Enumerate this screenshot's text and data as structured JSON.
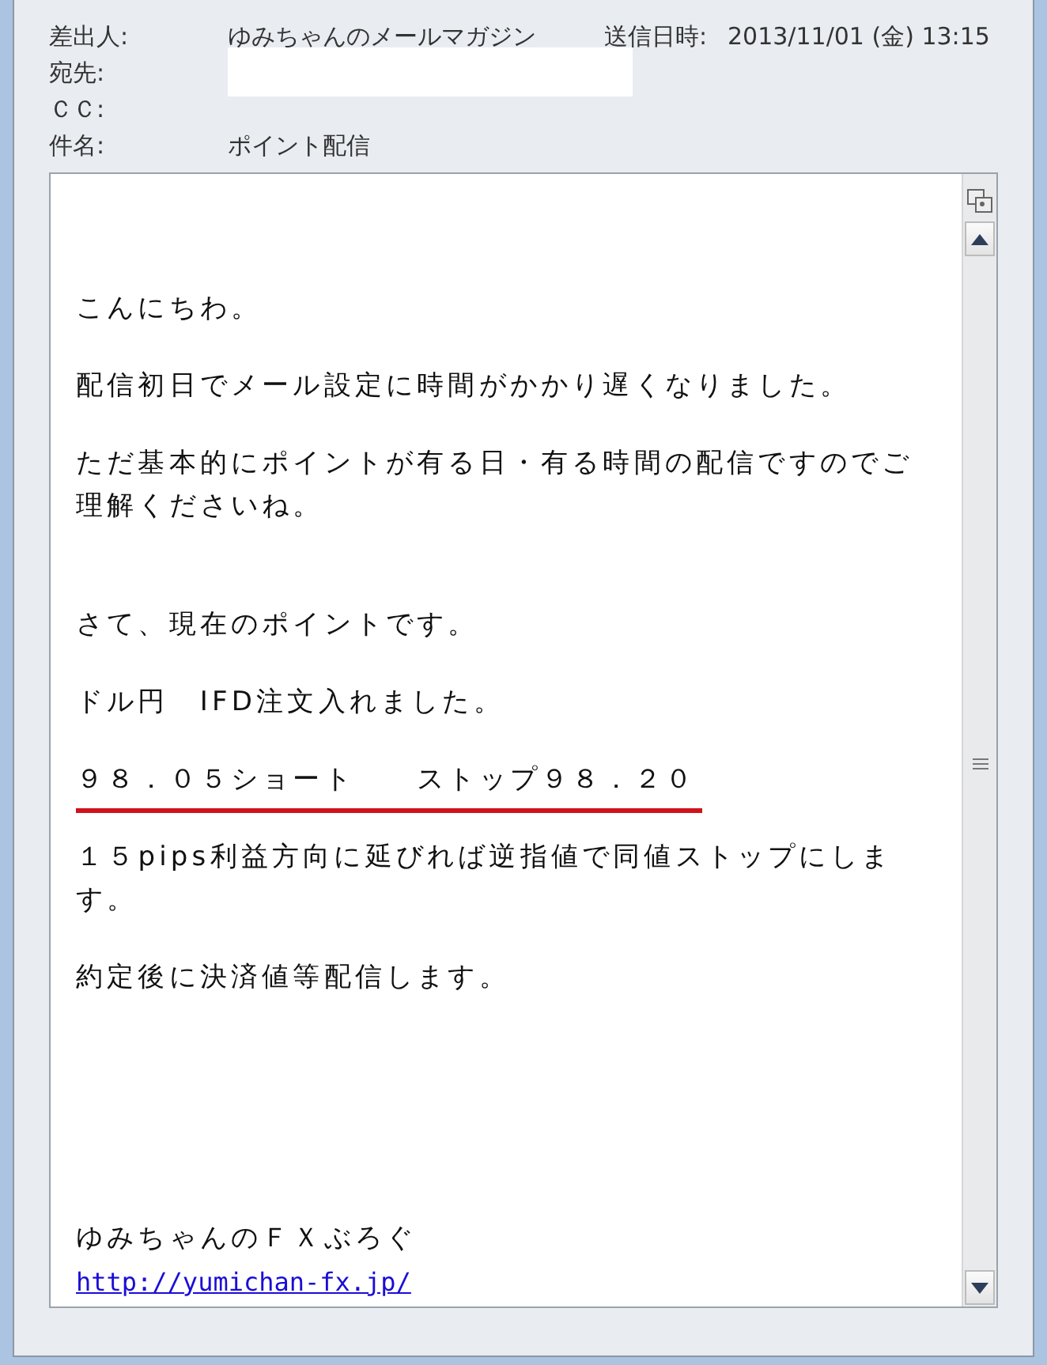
{
  "header": {
    "from_label": "差出人:",
    "from": "ゆみちゃんのメールマガジン",
    "sent_label": "送信日時:",
    "sent": "2013/11/01 (金) 13:15",
    "to_label": "宛先:",
    "cc_label": "ＣＣ:",
    "subject_label": "件名:",
    "subject": "ポイント配信"
  },
  "body": {
    "sections": [
      [
        {
          "kind": "text",
          "text": "こんにちわ。"
        },
        {
          "kind": "text",
          "text": "配信初日でメール設定に時間がかかり遅くなりました。"
        },
        {
          "kind": "text",
          "text": "ただ基本的にポイントが有る日・有る時間の配信ですのでご理解くださいね。"
        }
      ],
      [
        {
          "kind": "text",
          "text": "さて、現在のポイントです。"
        },
        {
          "kind": "text",
          "text": "ドル円　IFD注文入れました。"
        },
        {
          "kind": "underlined",
          "text": "９８．０５ショート　　ストップ９８．２０"
        },
        {
          "kind": "text",
          "text": "１５pips利益方向に延びれば逆指値で同値ストップにします。"
        },
        {
          "kind": "text",
          "text": "約定後に決済値等配信します。"
        }
      ]
    ],
    "signature": [
      {
        "kind": "text",
        "text": "ゆみちゃんのＦＸぶろぐ"
      },
      {
        "kind": "link",
        "text": "http://yumichan-fx.jp/"
      }
    ]
  }
}
